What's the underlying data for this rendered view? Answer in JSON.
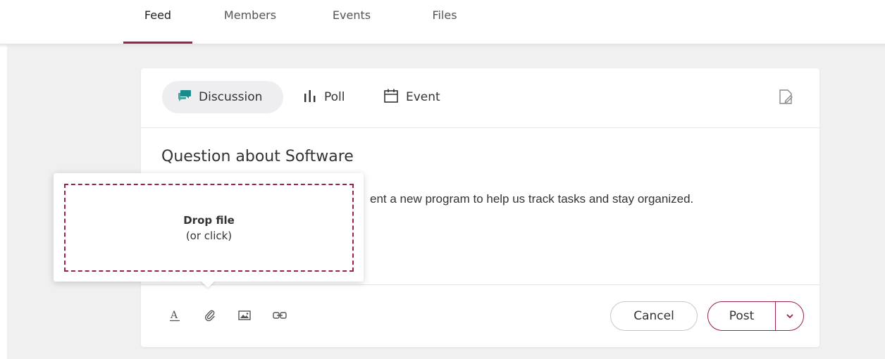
{
  "nav": {
    "tabs": [
      {
        "label": "Feed",
        "active": true
      },
      {
        "label": "Members",
        "active": false
      },
      {
        "label": "Events",
        "active": false
      },
      {
        "label": "Files",
        "active": false
      }
    ]
  },
  "composer": {
    "post_types": [
      {
        "label": "Discussion",
        "icon": "chat-bubbles-icon",
        "selected": true
      },
      {
        "label": "Poll",
        "icon": "bar-chart-icon",
        "selected": false
      },
      {
        "label": "Event",
        "icon": "calendar-icon",
        "selected": false
      }
    ],
    "draft_icon": "edit-document-icon",
    "title": "Question about Software",
    "body": "Does anyone know how to implement a new program to help us track tasks and stay organized.",
    "body_visible": "ent a new program to help us track tasks and stay organized.",
    "toolbar": [
      "text-format-icon",
      "attachment-icon",
      "image-icon",
      "link-icon"
    ],
    "cancel_label": "Cancel",
    "post_label": "Post"
  },
  "dropzone": {
    "title": "Drop file",
    "subtitle": "(or click)"
  },
  "colors": {
    "accent": "#9b2243",
    "page_bg": "#f0f0f1",
    "selected_pill": "#eeeef0",
    "chat_icon": "#1a8a8a"
  }
}
